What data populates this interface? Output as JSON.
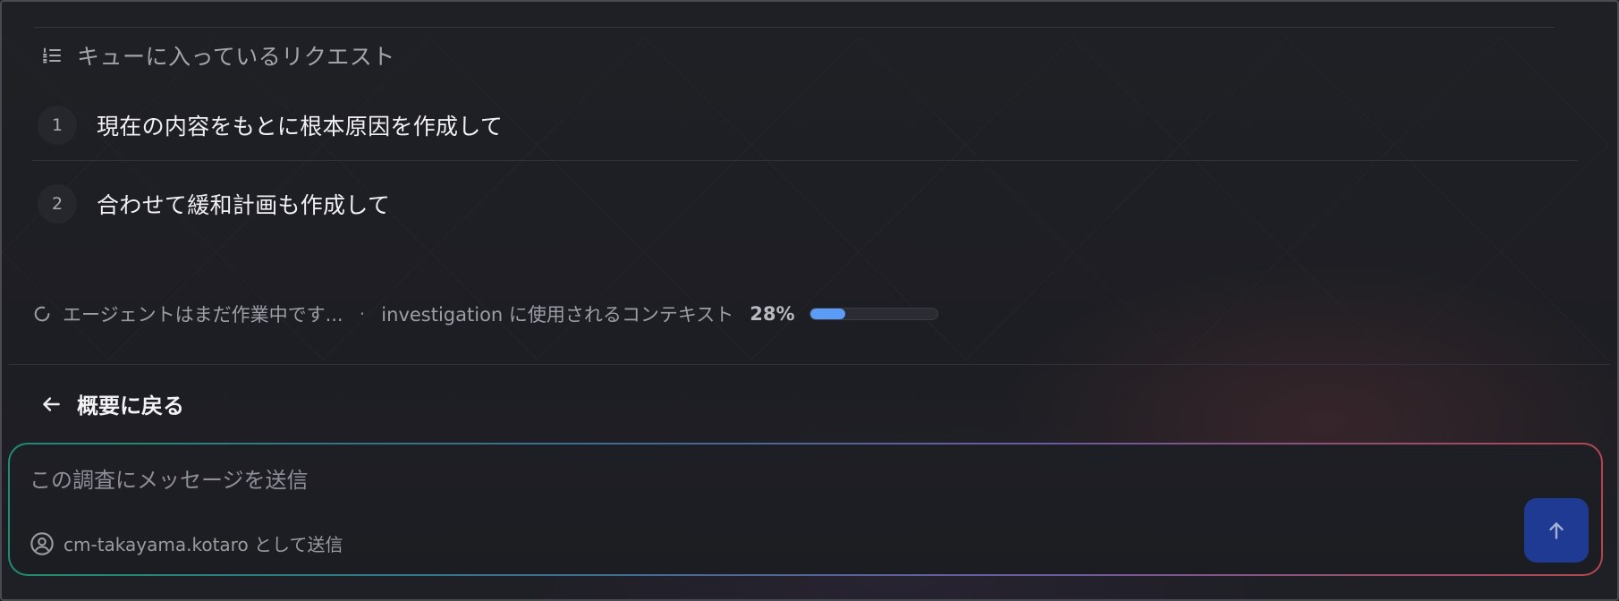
{
  "queue": {
    "title": "キューに入っているリクエスト",
    "items": [
      {
        "number": "1",
        "text": "現在の内容をもとに根本原因を作成して"
      },
      {
        "number": "2",
        "text": "合わせて緩和計画も作成して"
      }
    ]
  },
  "status": {
    "working_text": "エージェントはまだ作業中です...",
    "separator": "·",
    "context_text": "investigation に使用されるコンテキスト",
    "context_percent": "28%",
    "context_fraction": 0.28
  },
  "back": {
    "label": "概要に戻る"
  },
  "composer": {
    "placeholder": "この調査にメッセージを送信",
    "sender_text": "cm-takayama.kotaro として送信"
  },
  "icons": {
    "queue": "list-ordered-icon",
    "status": "spinner-icon",
    "back": "arrow-left-icon",
    "sender": "user-circle-icon",
    "send": "arrow-up-icon"
  },
  "colors": {
    "progress_fill": "#5b9cf6",
    "send_button": "#1f3a92"
  }
}
